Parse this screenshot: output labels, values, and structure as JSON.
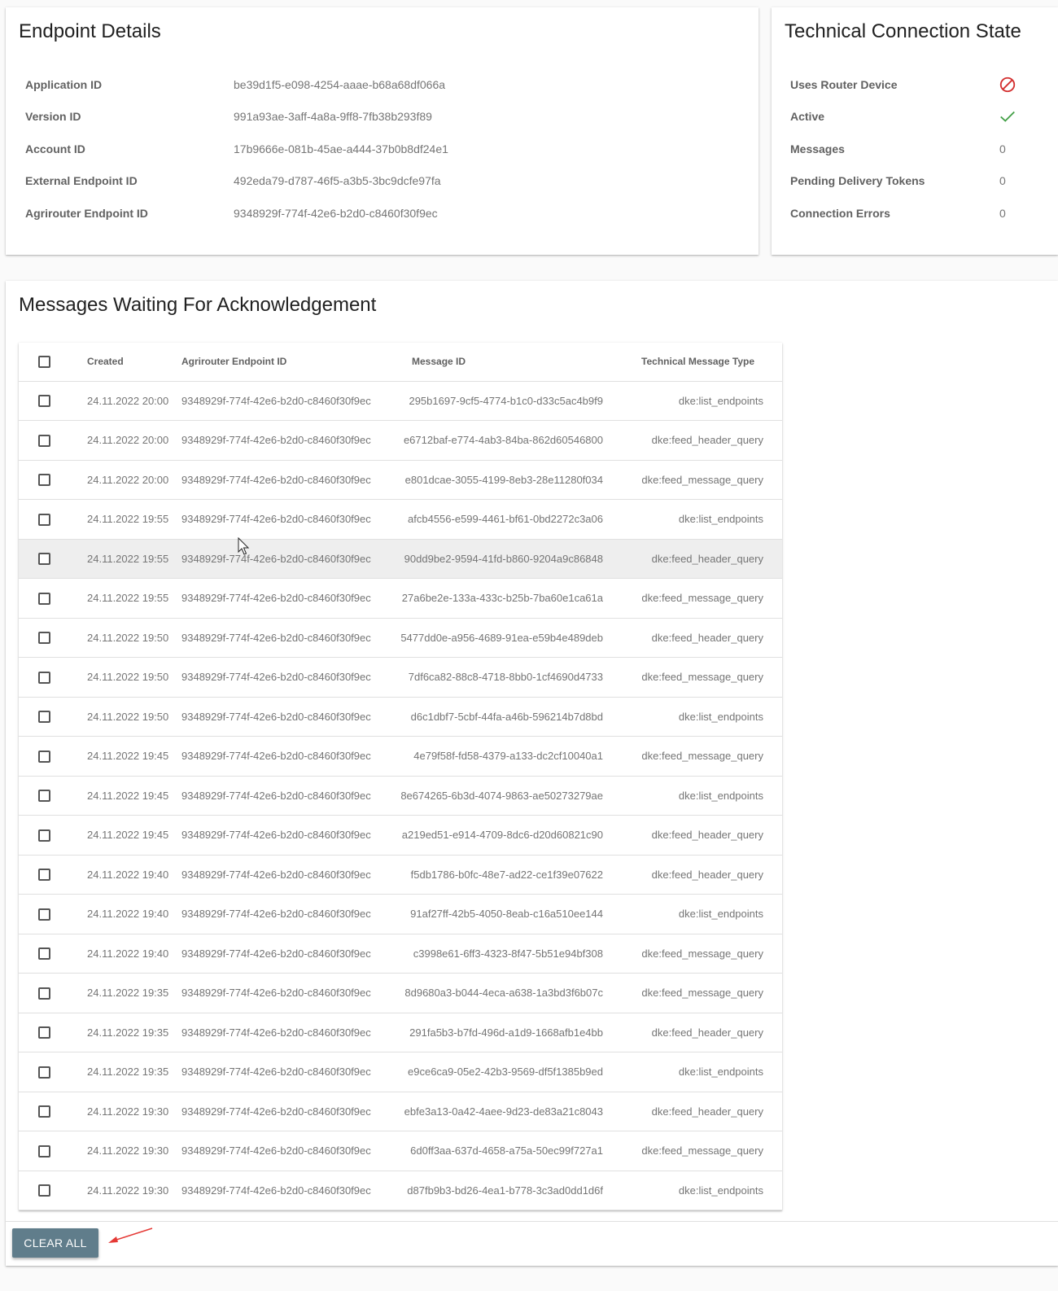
{
  "endpoint_details": {
    "title": "Endpoint Details",
    "rows": [
      {
        "label": "Application ID",
        "value": "be39d1f5-e098-4254-aaae-b68a68df066a"
      },
      {
        "label": "Version ID",
        "value": "991a93ae-3aff-4a8a-9ff8-7fb38b293f89"
      },
      {
        "label": "Account ID",
        "value": "17b9666e-081b-45ae-a444-37b0b8df24e1"
      },
      {
        "label": "External Endpoint ID",
        "value": "492eda79-d787-46f5-a3b5-3bc9dcfe97fa"
      },
      {
        "label": "Agrirouter Endpoint ID",
        "value": "9348929f-774f-42e6-b2d0-c8460f30f9ec"
      }
    ]
  },
  "technical_state": {
    "title": "Technical Connection State",
    "uses_router_device_label": "Uses Router Device",
    "uses_router_device_icon": "blocked-icon",
    "active_label": "Active",
    "active_icon": "check-icon",
    "messages_label": "Messages",
    "messages_value": "0",
    "pending_label": "Pending Delivery Tokens",
    "pending_value": "0",
    "errors_label": "Connection Errors",
    "errors_value": "0",
    "colors": {
      "blocked": "#d32f2f",
      "active": "#43a047"
    }
  },
  "messages": {
    "title": "Messages Waiting For Acknowledgement",
    "columns": {
      "created": "Created",
      "endpoint": "Agrirouter Endpoint ID",
      "message_id": "Message ID",
      "type": "Technical Message Type"
    },
    "rows": [
      {
        "created": "24.11.2022 20:00",
        "endpoint": "9348929f-774f-42e6-b2d0-c8460f30f9ec",
        "message_id": "295b1697-9cf5-4774-b1c0-d33c5ac4b9f9",
        "type": "dke:list_endpoints"
      },
      {
        "created": "24.11.2022 20:00",
        "endpoint": "9348929f-774f-42e6-b2d0-c8460f30f9ec",
        "message_id": "e6712baf-e774-4ab3-84ba-862d60546800",
        "type": "dke:feed_header_query"
      },
      {
        "created": "24.11.2022 20:00",
        "endpoint": "9348929f-774f-42e6-b2d0-c8460f30f9ec",
        "message_id": "e801dcae-3055-4199-8eb3-28e11280f034",
        "type": "dke:feed_message_query"
      },
      {
        "created": "24.11.2022 19:55",
        "endpoint": "9348929f-774f-42e6-b2d0-c8460f30f9ec",
        "message_id": "afcb4556-e599-4461-bf61-0bd2272c3a06",
        "type": "dke:list_endpoints"
      },
      {
        "created": "24.11.2022 19:55",
        "endpoint": "9348929f-774f-42e6-b2d0-c8460f30f9ec",
        "message_id": "90dd9be2-9594-41fd-b860-9204a9c86848",
        "type": "dke:feed_header_query"
      },
      {
        "created": "24.11.2022 19:55",
        "endpoint": "9348929f-774f-42e6-b2d0-c8460f30f9ec",
        "message_id": "27a6be2e-133a-433c-b25b-7ba60e1ca61a",
        "type": "dke:feed_message_query"
      },
      {
        "created": "24.11.2022 19:50",
        "endpoint": "9348929f-774f-42e6-b2d0-c8460f30f9ec",
        "message_id": "5477dd0e-a956-4689-91ea-e59b4e489deb",
        "type": "dke:feed_header_query"
      },
      {
        "created": "24.11.2022 19:50",
        "endpoint": "9348929f-774f-42e6-b2d0-c8460f30f9ec",
        "message_id": "7df6ca82-88c8-4718-8bb0-1cf4690d4733",
        "type": "dke:feed_message_query"
      },
      {
        "created": "24.11.2022 19:50",
        "endpoint": "9348929f-774f-42e6-b2d0-c8460f30f9ec",
        "message_id": "d6c1dbf7-5cbf-44fa-a46b-596214b7d8bd",
        "type": "dke:list_endpoints"
      },
      {
        "created": "24.11.2022 19:45",
        "endpoint": "9348929f-774f-42e6-b2d0-c8460f30f9ec",
        "message_id": "4e79f58f-fd58-4379-a133-dc2cf10040a1",
        "type": "dke:feed_message_query"
      },
      {
        "created": "24.11.2022 19:45",
        "endpoint": "9348929f-774f-42e6-b2d0-c8460f30f9ec",
        "message_id": "8e674265-6b3d-4074-9863-ae50273279ae",
        "type": "dke:list_endpoints"
      },
      {
        "created": "24.11.2022 19:45",
        "endpoint": "9348929f-774f-42e6-b2d0-c8460f30f9ec",
        "message_id": "a219ed51-e914-4709-8dc6-d20d60821c90",
        "type": "dke:feed_header_query"
      },
      {
        "created": "24.11.2022 19:40",
        "endpoint": "9348929f-774f-42e6-b2d0-c8460f30f9ec",
        "message_id": "f5db1786-b0fc-48e7-ad22-ce1f39e07622",
        "type": "dke:feed_header_query"
      },
      {
        "created": "24.11.2022 19:40",
        "endpoint": "9348929f-774f-42e6-b2d0-c8460f30f9ec",
        "message_id": "91af27ff-42b5-4050-8eab-c16a510ee144",
        "type": "dke:list_endpoints"
      },
      {
        "created": "24.11.2022 19:40",
        "endpoint": "9348929f-774f-42e6-b2d0-c8460f30f9ec",
        "message_id": "c3998e61-6ff3-4323-8f47-5b51e94bf308",
        "type": "dke:feed_message_query"
      },
      {
        "created": "24.11.2022 19:35",
        "endpoint": "9348929f-774f-42e6-b2d0-c8460f30f9ec",
        "message_id": "8d9680a3-b044-4eca-a638-1a3bd3f6b07c",
        "type": "dke:feed_message_query"
      },
      {
        "created": "24.11.2022 19:35",
        "endpoint": "9348929f-774f-42e6-b2d0-c8460f30f9ec",
        "message_id": "291fa5b3-b7fd-496d-a1d9-1668afb1e4bb",
        "type": "dke:feed_header_query"
      },
      {
        "created": "24.11.2022 19:35",
        "endpoint": "9348929f-774f-42e6-b2d0-c8460f30f9ec",
        "message_id": "e9ce6ca9-05e2-42b3-9569-df5f1385b9ed",
        "type": "dke:list_endpoints"
      },
      {
        "created": "24.11.2022 19:30",
        "endpoint": "9348929f-774f-42e6-b2d0-c8460f30f9ec",
        "message_id": "ebfe3a13-0a42-4aee-9d23-de83a21c8043",
        "type": "dke:feed_header_query"
      },
      {
        "created": "24.11.2022 19:30",
        "endpoint": "9348929f-774f-42e6-b2d0-c8460f30f9ec",
        "message_id": "6d0ff3aa-637d-4658-a75a-50ec99f727a1",
        "type": "dke:feed_message_query"
      },
      {
        "created": "24.11.2022 19:30",
        "endpoint": "9348929f-774f-42e6-b2d0-c8460f30f9ec",
        "message_id": "d87fb9b3-bd26-4ea1-b778-3c3ad0dd1d6f",
        "type": "dke:list_endpoints"
      }
    ],
    "hovered_row": 4,
    "clear_all_label": "CLEAR ALL",
    "button_color": "#607d8b",
    "annotation_arrow_color": "#e53935"
  }
}
